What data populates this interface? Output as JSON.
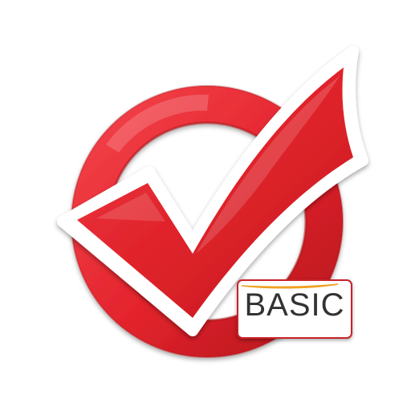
{
  "icon": {
    "name": "checkmark-circle-logo",
    "colors": {
      "red": "#e3232c",
      "red_dark": "#b5161d",
      "red_light": "#f4545a",
      "outline": "#ffffff",
      "badge_border": "#c9222a",
      "badge_text": "#333333",
      "swoosh": "#f0a020"
    }
  },
  "badge": {
    "label": "BASIC",
    "accent_icon": "orange-swoosh-icon"
  }
}
